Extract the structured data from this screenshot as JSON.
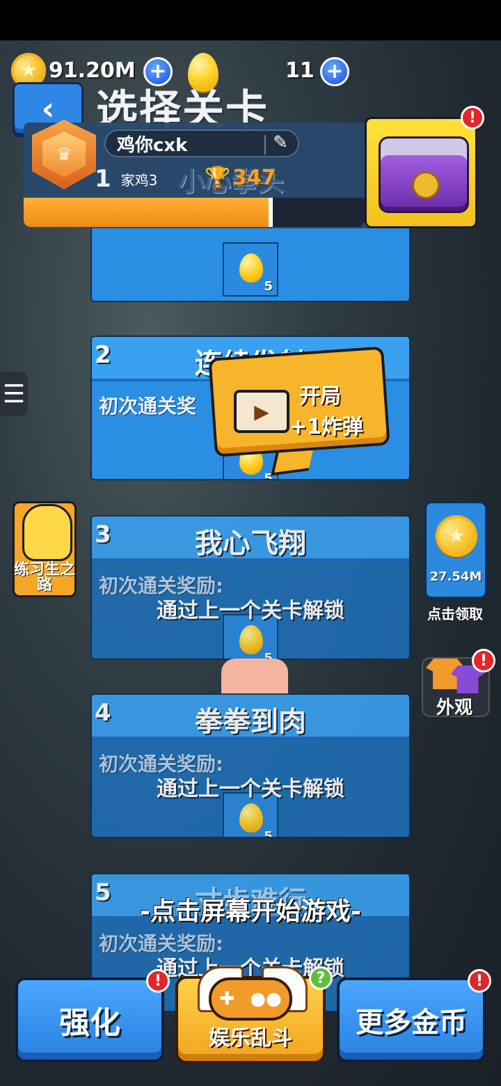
{
  "currency": {
    "coins": "91.20M",
    "eggs": "11"
  },
  "header": {
    "back_glyph": "‹",
    "title": "选择关卡"
  },
  "profile": {
    "name": "鸡你cxk",
    "rank_level": "1",
    "rank_name": "家鸡3",
    "rank_title": "小心拳头",
    "trophies": "347",
    "xp_progress_percent": 73
  },
  "levels": [
    {
      "num": "",
      "title": "",
      "reward_label": "",
      "note": "",
      "reward_count": "5",
      "state": "partial"
    },
    {
      "num": "2",
      "title": "连续发射",
      "reward_label": "初次通关奖",
      "note": "",
      "reward_count": "5",
      "state": "unlocked"
    },
    {
      "num": "3",
      "title": "我心飞翔",
      "reward_label": "初次通关奖励:",
      "note": "通过上一个关卡解锁",
      "reward_count": "5",
      "state": "locked"
    },
    {
      "num": "4",
      "title": "拳拳到肉",
      "reward_label": "初次通关奖励:",
      "note": "通过上一个关卡解锁",
      "reward_count": "5",
      "state": "locked"
    },
    {
      "num": "5",
      "title": "寸步难行",
      "reward_label": "初次通关奖励:",
      "note": "通过上一个关卡解锁",
      "reward_count": "",
      "state": "locked"
    }
  ],
  "popup": {
    "line1": "开局",
    "line2": "+1炸弹"
  },
  "side": {
    "menu_glyph": "☰",
    "trainee_label": "练习生之路",
    "coin_amount": "27.54M",
    "coin_claim_label": "点击领取",
    "outfit_label": "外观"
  },
  "tap_message": "-点击屏幕开始游戏-",
  "bottom": {
    "upgrade_label": "强化",
    "center_label": "娱乐乱斗",
    "more_coins_label": "更多金币"
  },
  "icons": {
    "coin": "star-coin-icon",
    "egg": "golden-egg-icon",
    "plus": "plus-icon",
    "alert": "!",
    "help": "?"
  },
  "colors": {
    "card_blue": "#2a8fe3",
    "header_blue": "#3aa1f0",
    "popup_orange": "#f6b52a",
    "alert_red": "#e3262b",
    "xp_orange": "#f08a14"
  }
}
